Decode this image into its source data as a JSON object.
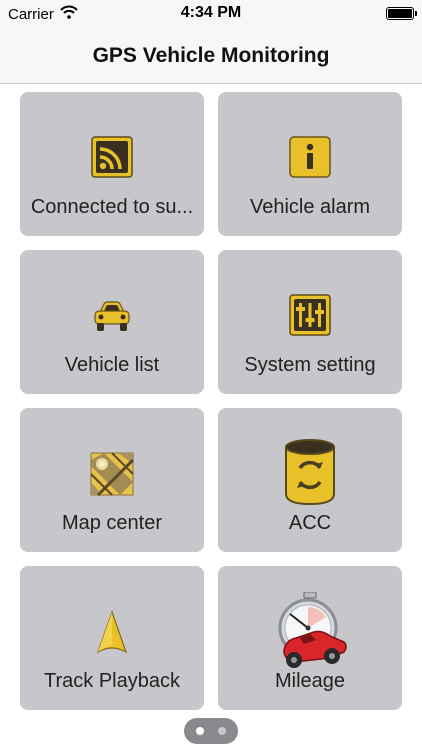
{
  "status_bar": {
    "carrier": "Carrier",
    "time": "4:34 PM"
  },
  "nav": {
    "title": "GPS Vehicle Monitoring"
  },
  "tiles": [
    {
      "label": "Connected to su...",
      "icon": "rss-icon"
    },
    {
      "label": "Vehicle alarm",
      "icon": "info-icon"
    },
    {
      "label": "Vehicle list",
      "icon": "car-icon"
    },
    {
      "label": "System setting",
      "icon": "sliders-icon"
    },
    {
      "label": "Map center",
      "icon": "map-icon"
    },
    {
      "label": "ACC",
      "icon": "refresh-cylinder-icon"
    },
    {
      "label": "Track Playback",
      "icon": "navigation-arrow-icon"
    },
    {
      "label": "Mileage",
      "icon": "stopwatch-car-icon"
    }
  ],
  "pager": {
    "page_count": 2,
    "current_page": 1
  },
  "colors": {
    "tile_background": "#c7c7cb",
    "icon_gold": "#e8c02a",
    "icon_dark": "#3a3020"
  }
}
